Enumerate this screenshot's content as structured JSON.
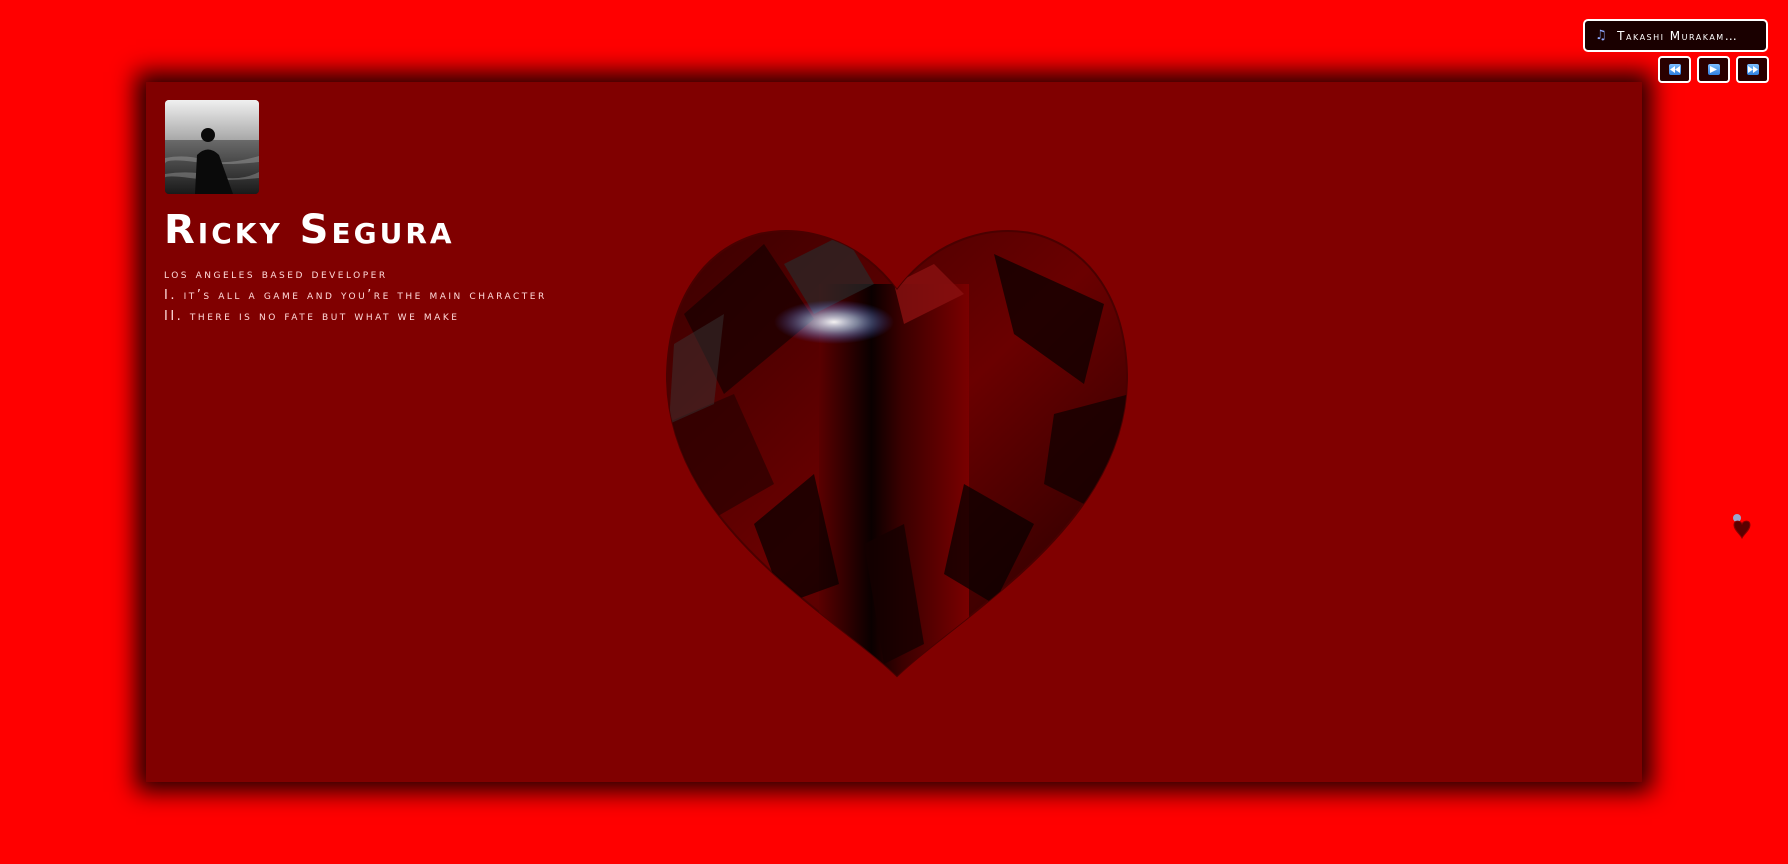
{
  "profile": {
    "name": "Ricky Segura",
    "bio_lines": [
      "los angeles based developer",
      "I. it’s all a game and you’re the main character",
      "II. there is no fate but what we make"
    ]
  },
  "music_player": {
    "track_title": "Takashi Murakam…",
    "icon": "music-note-icon",
    "controls": {
      "previous": "previous-track-icon",
      "play": "play-icon",
      "next": "next-track-icon"
    }
  },
  "colors": {
    "background": "#ff0000",
    "card": "#800000",
    "heart_gem": "#5a0000",
    "control_glyph": "#4a9aff"
  }
}
